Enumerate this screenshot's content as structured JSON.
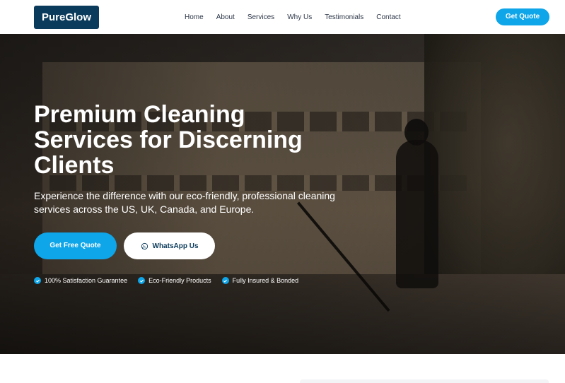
{
  "header": {
    "logo": "PureGlow",
    "nav": [
      "Home",
      "About",
      "Services",
      "Why Us",
      "Testimonials",
      "Contact"
    ],
    "cta_label": "Get Quote"
  },
  "hero": {
    "title": "Premium Cleaning Services for Discerning Clients",
    "subtitle": "Experience the difference with our eco-friendly, professional cleaning services across the US, UK, Canada, and Europe.",
    "primary_button": "Get Free Quote",
    "secondary_button": "WhatsApp Us",
    "secondary_icon": "whatsapp-icon",
    "features": [
      "100% Satisfaction Guarantee",
      "Eco-Friendly Products",
      "Fully Insured & Bonded"
    ]
  },
  "colors": {
    "brand_navy": "#0b3b5c",
    "accent": "#0ea5e9",
    "text_dark": "#2d3748"
  }
}
